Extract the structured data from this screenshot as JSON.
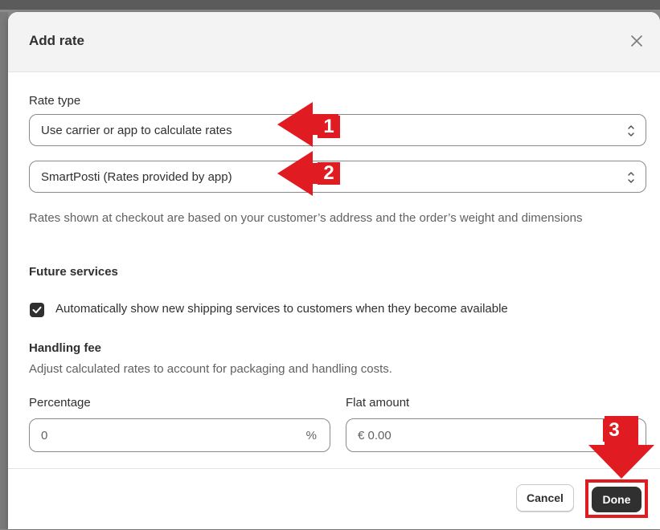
{
  "modal": {
    "title": "Add rate",
    "close_icon": "close-icon"
  },
  "rate_type": {
    "label": "Rate type",
    "method_value": "Use carrier or app to calculate rates",
    "service_value": "SmartPosti (Rates provided by app)",
    "help_text": "Rates shown at checkout are based on your customer’s address and the order’s weight and dimensions"
  },
  "future_services": {
    "heading": "Future services",
    "checkbox_label": "Automatically show new shipping services to customers when they become available",
    "checked": true
  },
  "handling_fee": {
    "heading": "Handling fee",
    "help_text": "Adjust calculated rates to account for packaging and handling costs.",
    "percentage_label": "Percentage",
    "percentage_value": "0",
    "percentage_suffix": "%",
    "flat_label": "Flat amount",
    "flat_value": "€ 0.00"
  },
  "footer": {
    "cancel_label": "Cancel",
    "done_label": "Done"
  },
  "annotations": {
    "step1": "1",
    "step2": "2",
    "step3": "3",
    "color": "#e11b22"
  }
}
